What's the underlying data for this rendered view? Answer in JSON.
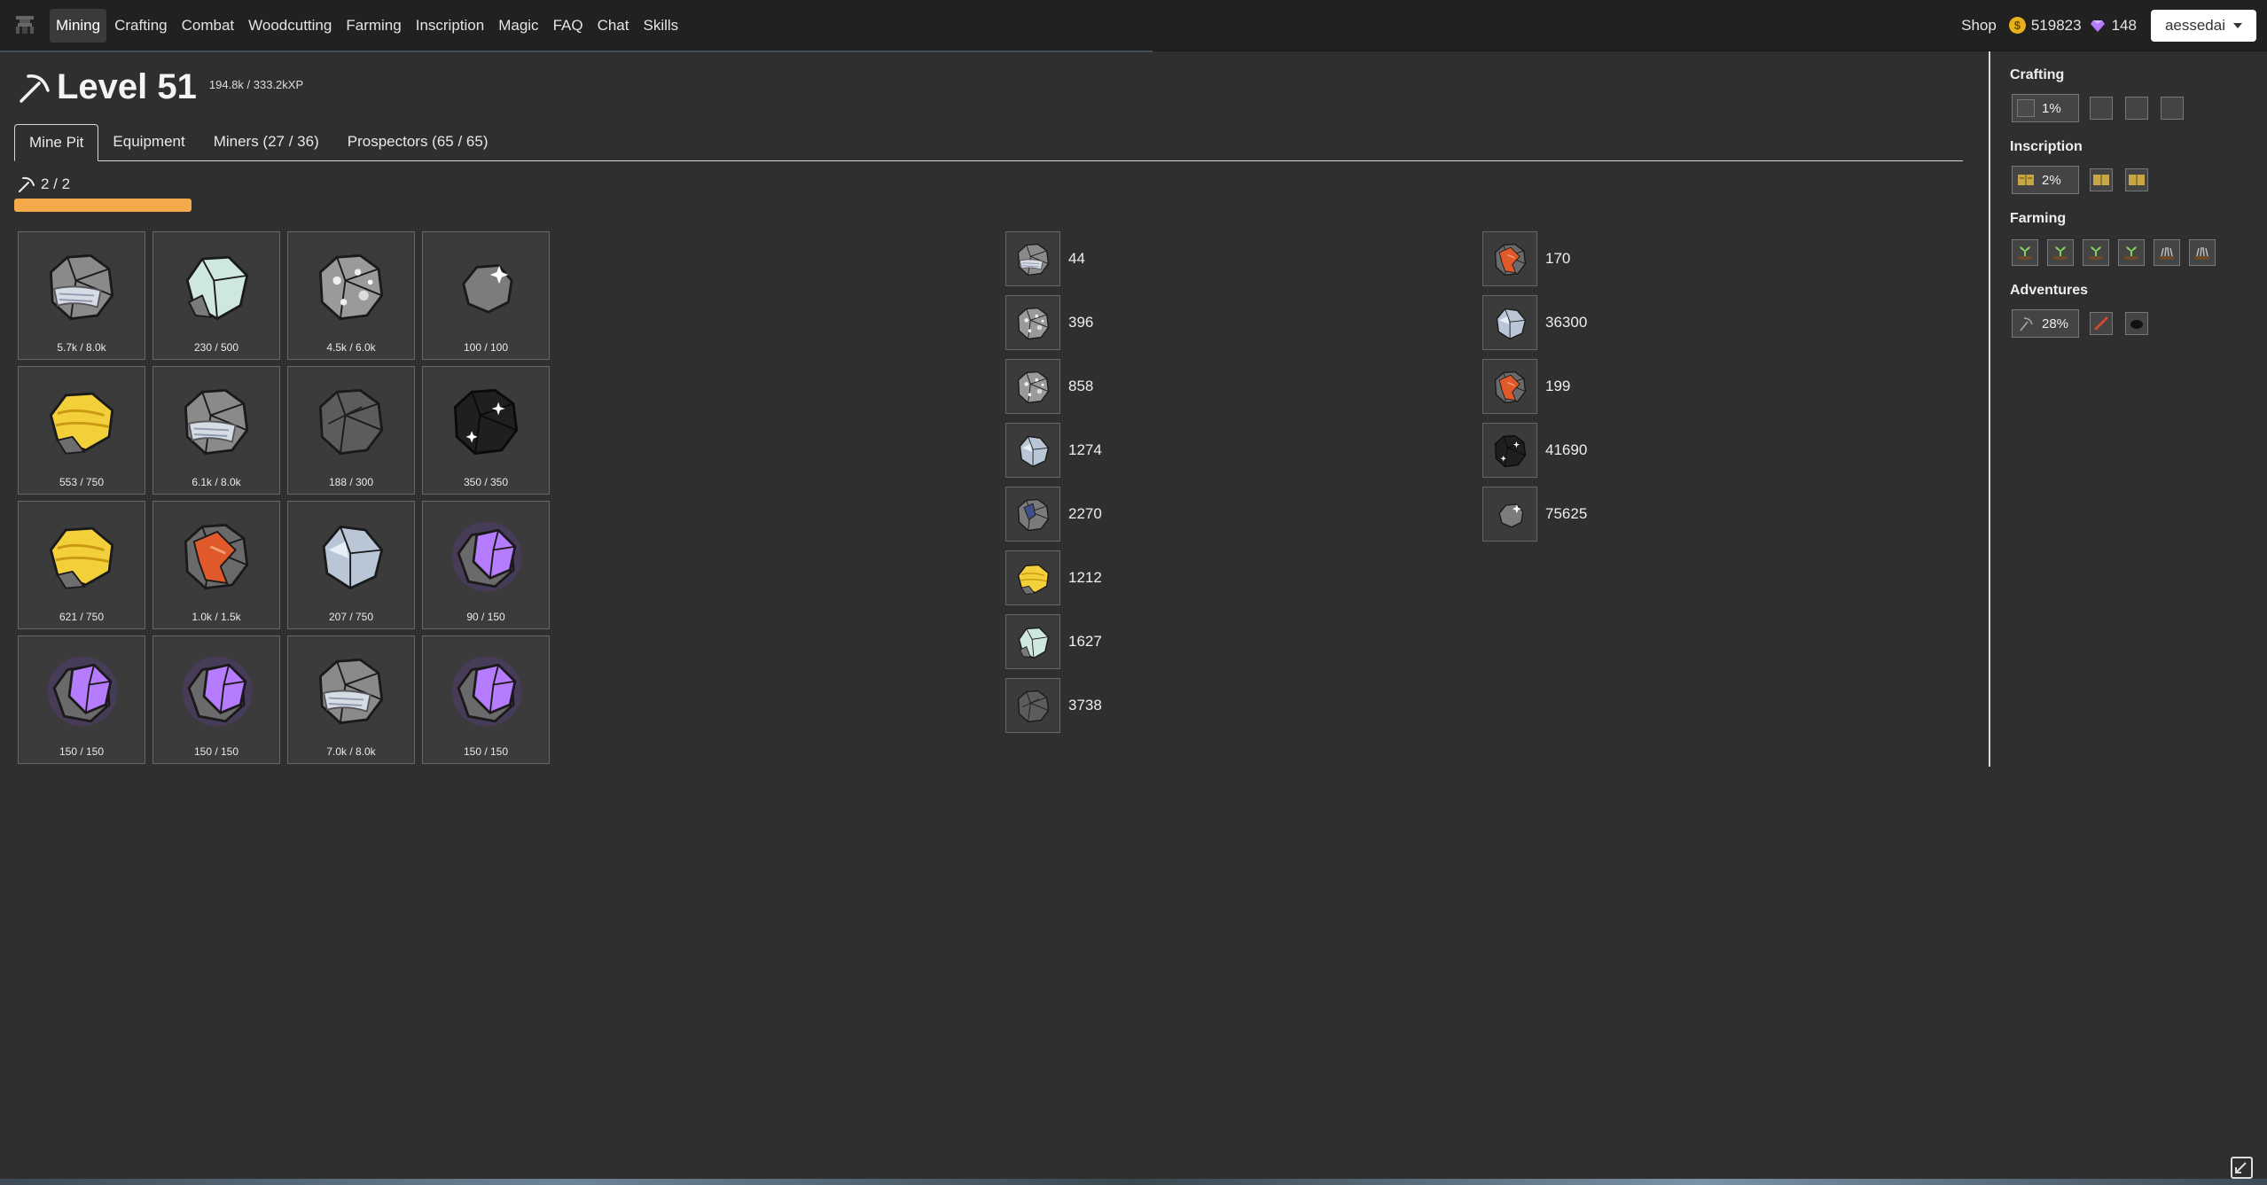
{
  "nav": {
    "items": [
      "Mining",
      "Crafting",
      "Combat",
      "Woodcutting",
      "Farming",
      "Inscription",
      "Magic",
      "FAQ",
      "Chat",
      "Skills"
    ],
    "shop_label": "Shop",
    "gold": "519823",
    "gems": "148",
    "username": "aessedai"
  },
  "header": {
    "level": "Level 51",
    "xp": "194.8k / 333.2kXP"
  },
  "tabs": [
    "Mine Pit",
    "Equipment",
    "Miners (27 / 36)",
    "Prospectors (65 / 65)"
  ],
  "miner_slots": "2 / 2",
  "mine_grid": [
    {
      "ore": "silver-stone",
      "cap": "5.7k / 8.0k"
    },
    {
      "ore": "pale-crystal",
      "cap": "230 / 500"
    },
    {
      "ore": "speckled-rock",
      "cap": "4.5k / 6.0k"
    },
    {
      "ore": "grey-sparkle",
      "cap": "100 / 100"
    },
    {
      "ore": "gold",
      "cap": "553 / 750"
    },
    {
      "ore": "silver-stone",
      "cap": "6.1k / 8.0k"
    },
    {
      "ore": "dark-rock",
      "cap": "188 / 300"
    },
    {
      "ore": "coal",
      "cap": "350 / 350"
    },
    {
      "ore": "gold",
      "cap": "621 / 750"
    },
    {
      "ore": "copper",
      "cap": "1.0k / 1.5k"
    },
    {
      "ore": "mithril",
      "cap": "207 / 750"
    },
    {
      "ore": "amethyst",
      "cap": "90 / 150"
    },
    {
      "ore": "amethyst",
      "cap": "150 / 150"
    },
    {
      "ore": "amethyst",
      "cap": "150 / 150"
    },
    {
      "ore": "silver-stone",
      "cap": "7.0k / 8.0k"
    },
    {
      "ore": "amethyst",
      "cap": "150 / 150"
    }
  ],
  "inventory_left": [
    {
      "ore": "stone",
      "count": "44"
    },
    {
      "ore": "speckled-rock",
      "count": "396"
    },
    {
      "ore": "sparkle-rock",
      "count": "858"
    },
    {
      "ore": "pale-shard",
      "count": "1274"
    },
    {
      "ore": "blue-ore",
      "count": "2270"
    },
    {
      "ore": "gold",
      "count": "1212"
    },
    {
      "ore": "pale-crystal",
      "count": "1627"
    },
    {
      "ore": "dark-rock",
      "count": "3738"
    }
  ],
  "inventory_right": [
    {
      "ore": "copper",
      "count": "170"
    },
    {
      "ore": "mithril",
      "count": "36300"
    },
    {
      "ore": "copper-small",
      "count": "199"
    },
    {
      "ore": "coal",
      "count": "41690"
    },
    {
      "ore": "grey-dust",
      "count": "75625"
    }
  ],
  "sidebar": {
    "crafting": {
      "title": "Crafting",
      "pct": "1%"
    },
    "inscription": {
      "title": "Inscription",
      "pct": "2%"
    },
    "farming": {
      "title": "Farming"
    },
    "adventures": {
      "title": "Adventures",
      "pct": "28%"
    }
  },
  "colors": {
    "background": "#2f2f2f",
    "navbar": "#212121",
    "accent_orange": "#f4a94a",
    "gold": "#e8b21c",
    "gem": "#b77bff"
  }
}
